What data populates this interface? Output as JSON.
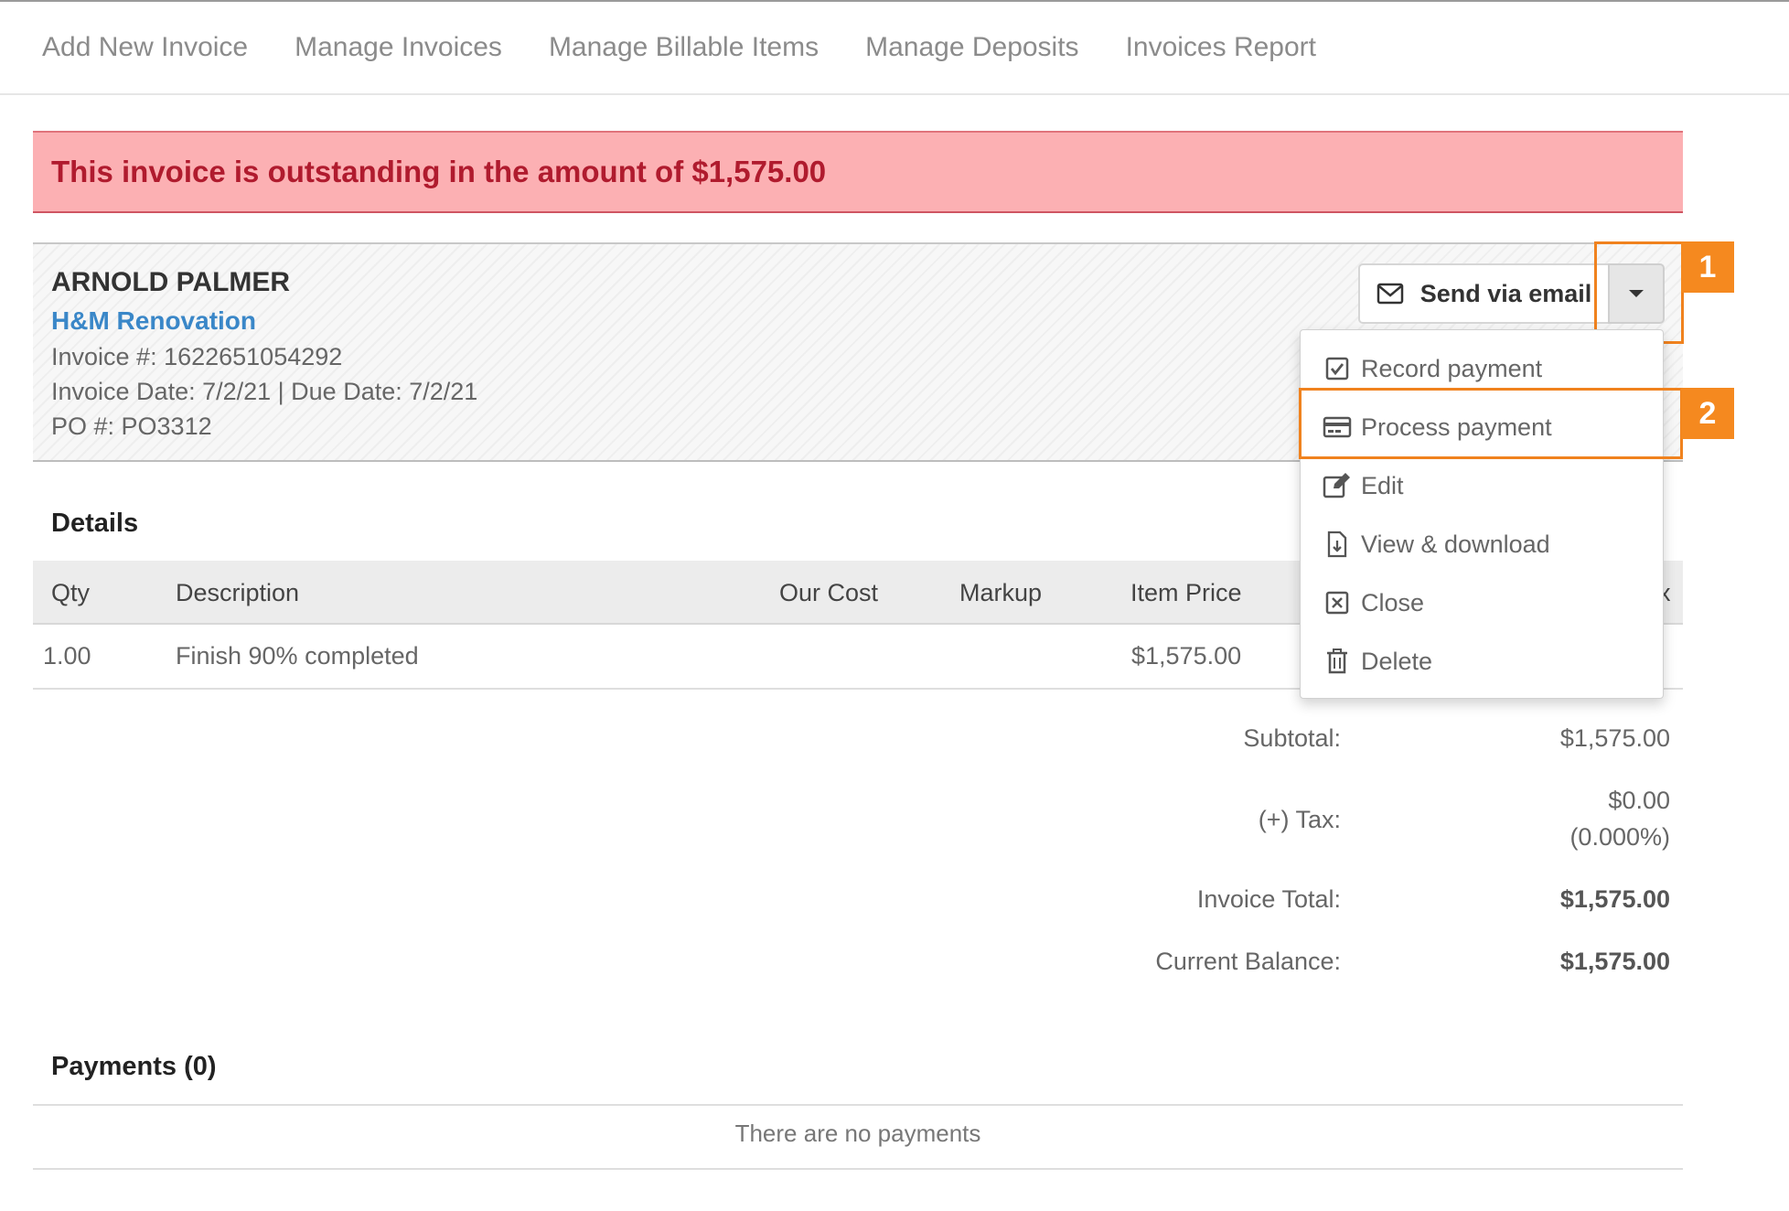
{
  "nav": {
    "items": [
      {
        "label": "Add New Invoice"
      },
      {
        "label": "Manage Invoices"
      },
      {
        "label": "Manage Billable Items"
      },
      {
        "label": "Manage Deposits"
      },
      {
        "label": "Invoices Report"
      }
    ]
  },
  "alert": {
    "message": "This invoice is outstanding in the amount of $1,575.00",
    "bg_color": "#fcb0b3",
    "text_color": "#b01b2e"
  },
  "invoice": {
    "client_name": "ARNOLD PALMER",
    "company": "H&M Renovation",
    "number_line": "Invoice #: 1622651054292",
    "dates_line": "Invoice Date: 7/2/21 | Due Date: 7/2/21",
    "po_line": "PO #: PO3312"
  },
  "actions": {
    "send_label": "Send via email",
    "send_icon": "envelope-icon",
    "caret_icon": "caret-down-icon",
    "menu": [
      {
        "label": "Record payment",
        "icon": "checkbox-icon"
      },
      {
        "label": "Process payment",
        "icon": "credit-card-icon"
      },
      {
        "label": "Edit",
        "icon": "edit-icon"
      },
      {
        "label": "View & download",
        "icon": "file-download-icon"
      },
      {
        "label": "Close",
        "icon": "close-box-icon"
      },
      {
        "label": "Delete",
        "icon": "trash-icon"
      }
    ]
  },
  "callouts": {
    "first": "1",
    "second": "2",
    "color": "#f0821e"
  },
  "details": {
    "title": "Details",
    "columns": [
      "Qty",
      "Description",
      "Our Cost",
      "Markup",
      "Item Price",
      "x"
    ],
    "rows": [
      {
        "qty": "1.00",
        "description": "Finish 90% completed",
        "our_cost": "",
        "markup": "",
        "item_price": "$1,575.00"
      }
    ]
  },
  "summary": {
    "subtotal_label": "Subtotal:",
    "subtotal_value": "$1,575.00",
    "tax_label": "(+) Tax:",
    "tax_value": "$0.00",
    "tax_rate": "(0.000%)",
    "total_label": "Invoice Total:",
    "total_value": "$1,575.00",
    "balance_label": "Current Balance:",
    "balance_value": "$1,575.00"
  },
  "payments": {
    "title": "Payments (0)",
    "empty_text": "There are no payments"
  }
}
